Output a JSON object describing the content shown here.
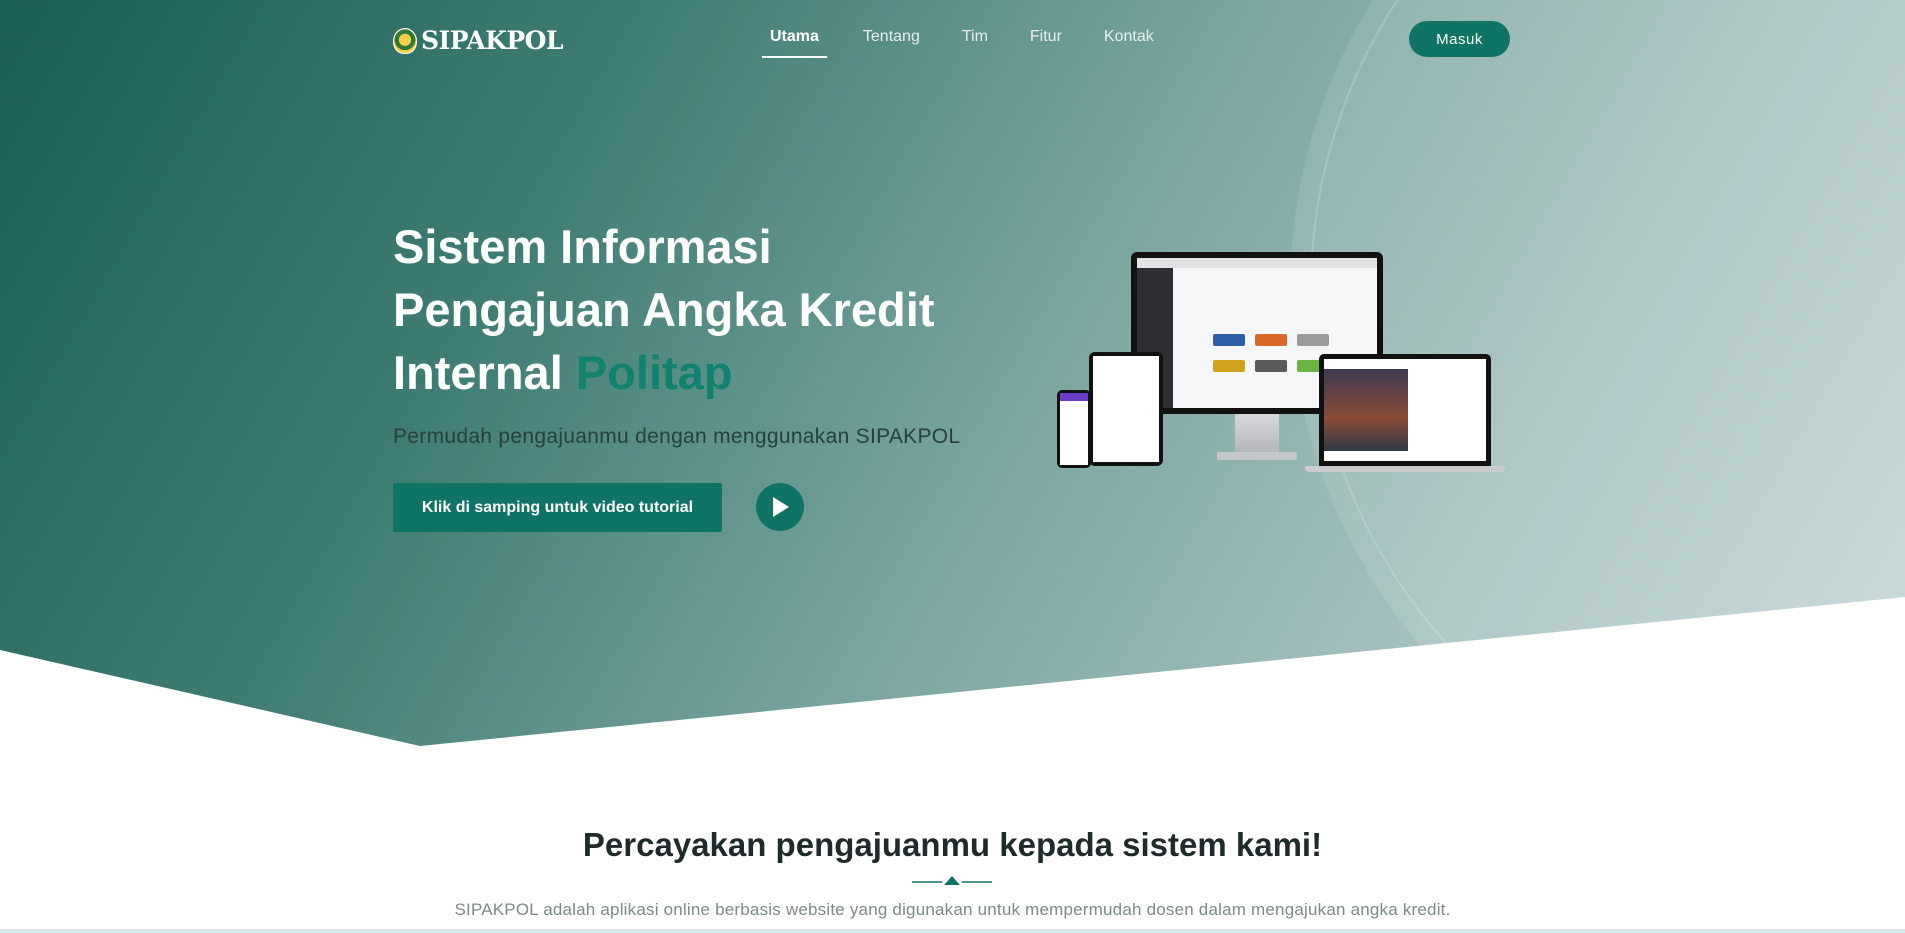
{
  "brand": {
    "logo_text": "SIPAKPOL"
  },
  "nav": {
    "items": [
      {
        "label": "Utama",
        "active": true
      },
      {
        "label": "Tentang",
        "active": false
      },
      {
        "label": "Tim",
        "active": false
      },
      {
        "label": "Fitur",
        "active": false
      },
      {
        "label": "Kontak",
        "active": false
      }
    ],
    "login_label": "Masuk"
  },
  "hero": {
    "title_line1": "Sistem Informasi",
    "title_line2": "Pengajuan Angka Kredit",
    "title_line3_prefix": "Internal",
    "title_line3_accent": "Politap",
    "subtitle": "Permudah pengajuanmu dengan menggunakan SIPAKPOL",
    "tutorial_button": "Klik di samping untuk video tutorial",
    "play_icon": "play-icon"
  },
  "about": {
    "title": "Percayakan pengajuanmu kepada sistem kami!",
    "description": "SIPAKPOL adalah aplikasi online berbasis website yang digunakan untuk mempermudah dosen dalam mengajukan angka kredit."
  },
  "colors": {
    "primary": "#0f7366",
    "accent_text": "#10826f",
    "hero_dark": "#1b5e55",
    "hero_light": "#c7d8d8"
  }
}
